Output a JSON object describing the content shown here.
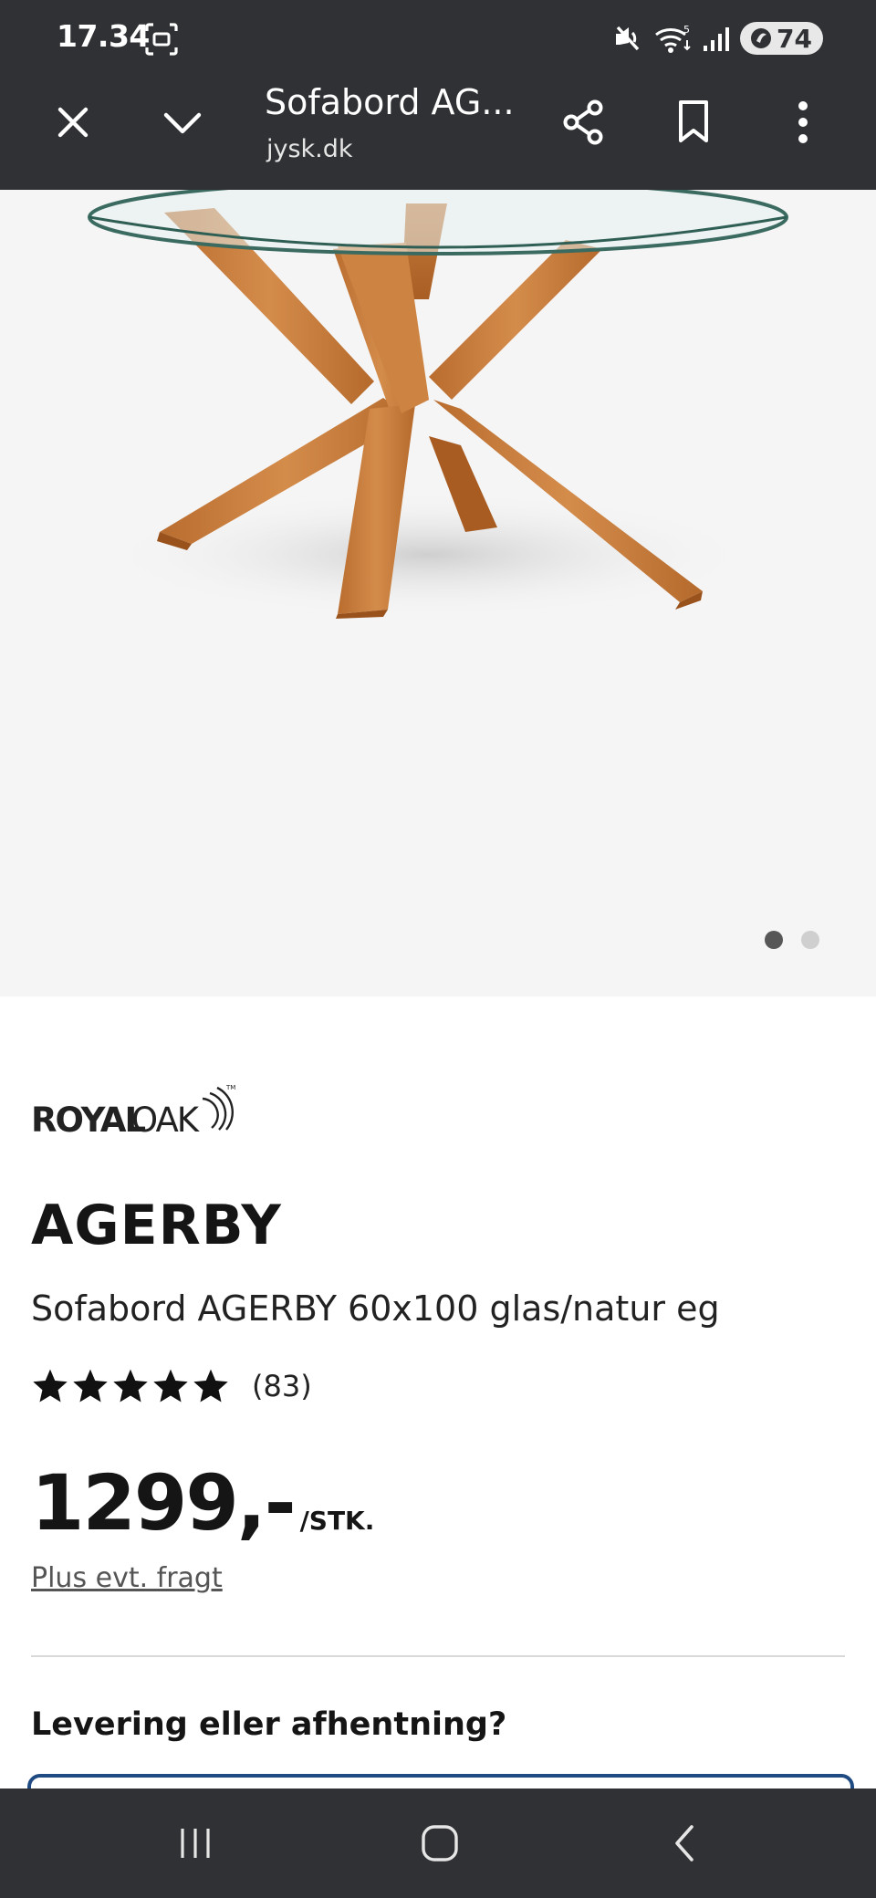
{
  "status_bar": {
    "time": "17.34",
    "battery": "74",
    "icons": [
      "screenshot-icon",
      "mute-icon",
      "wifi-icon",
      "signal-icon",
      "battery-icon"
    ]
  },
  "browser": {
    "title": "Sofabord AG...",
    "url": "jysk.dk",
    "icons": [
      "close-icon",
      "chevron-down-icon",
      "share-icon",
      "bookmark-icon",
      "more-vert-icon"
    ]
  },
  "gallery": {
    "image_count": 2,
    "active_index": 0
  },
  "product": {
    "brand": "ROYAL OAK",
    "name": "AGERBY",
    "description": "Sofabord AGERBY 60x100 glas/natur eg",
    "rating_stars": 5,
    "rating_count": "(83)",
    "price": "1299,-",
    "price_unit": "/STK.",
    "freight_link": "Plus evt. fragt"
  },
  "delivery": {
    "heading": "Levering eller afhentning?"
  },
  "nav_bar": {
    "icons": [
      "recents-icon",
      "home-icon",
      "back-icon"
    ]
  },
  "colors": {
    "chrome": "#303134",
    "hero_bg": "#f5f5f5",
    "wood": "#c57a3a",
    "accent_border": "#1f4a82"
  }
}
